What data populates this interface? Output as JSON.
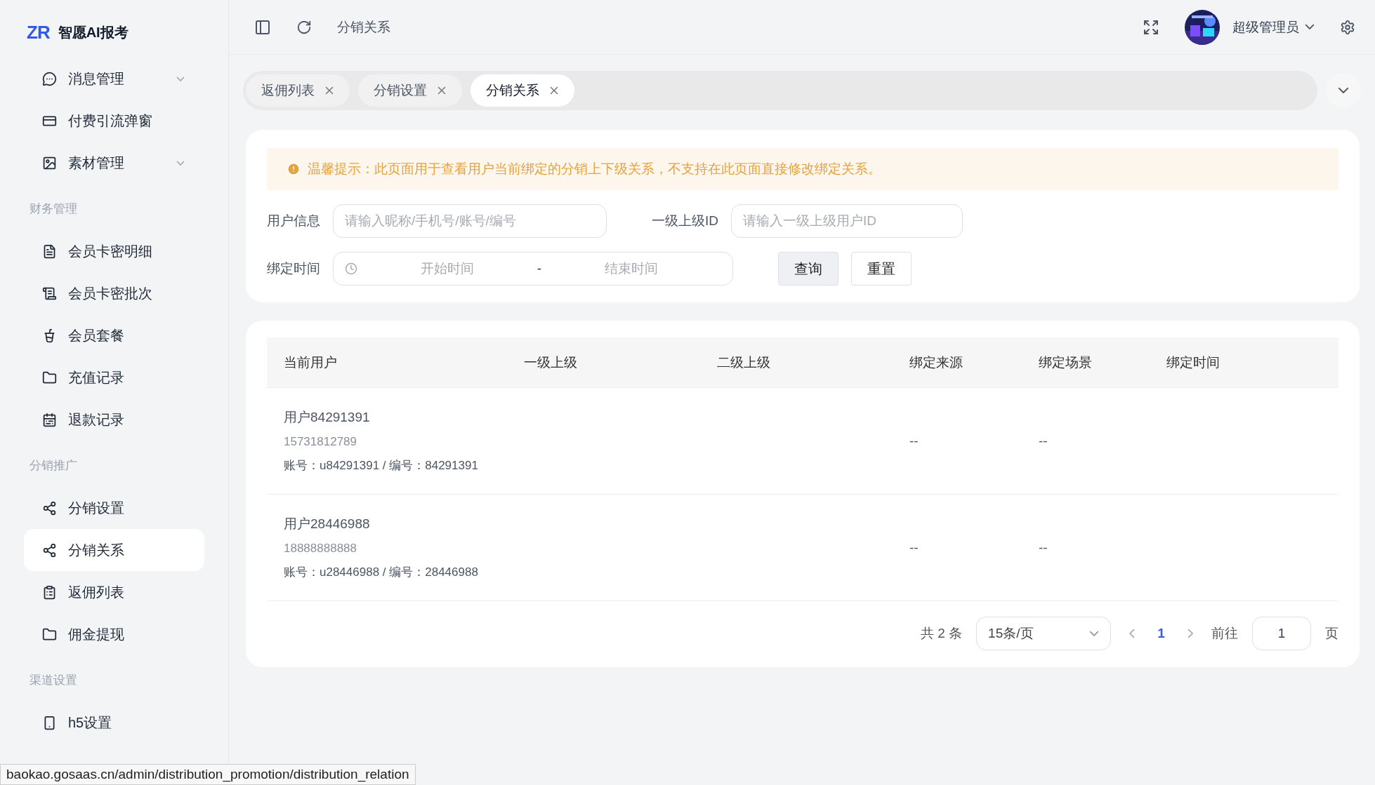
{
  "sidebar": {
    "logo_mark": "ZR",
    "logo_name": "智愿AI报考",
    "items": [
      {
        "kind": "item",
        "label": "消息管理",
        "expanded": false,
        "selected": false
      },
      {
        "kind": "item",
        "label": "付费引流弹窗",
        "selected": false
      },
      {
        "kind": "item",
        "label": "素材管理",
        "expanded": false,
        "selected": false
      },
      {
        "kind": "section",
        "label": "财务管理"
      },
      {
        "kind": "item",
        "label": "会员卡密明细",
        "selected": false
      },
      {
        "kind": "item",
        "label": "会员卡密批次",
        "selected": false
      },
      {
        "kind": "item",
        "label": "会员套餐",
        "selected": false
      },
      {
        "kind": "item",
        "label": "充值记录",
        "selected": false
      },
      {
        "kind": "item",
        "label": "退款记录",
        "selected": false
      },
      {
        "kind": "section",
        "label": "分销推广"
      },
      {
        "kind": "item",
        "label": "分销设置",
        "selected": false
      },
      {
        "kind": "item",
        "label": "分销关系",
        "selected": true
      },
      {
        "kind": "item",
        "label": "返佣列表",
        "selected": false
      },
      {
        "kind": "item",
        "label": "佣金提现",
        "selected": false
      },
      {
        "kind": "section",
        "label": "渠道设置"
      },
      {
        "kind": "item",
        "label": "h5设置",
        "selected": false
      }
    ]
  },
  "header": {
    "breadcrumb": "分销关系",
    "user": "超级管理员"
  },
  "tabs": [
    {
      "label": "返佣列表",
      "selected": false
    },
    {
      "label": "分销设置",
      "selected": false
    },
    {
      "label": "分销关系",
      "selected": true
    }
  ],
  "alert": "温馨提示：此页面用于查看用户当前绑定的分销上下级关系，不支持在此页面直接修改绑定关系。",
  "filters": {
    "user_info": {
      "label": "用户信息",
      "placeholder": "请输入昵称/手机号/账号/编号"
    },
    "parent_id": {
      "label": "一级上级ID",
      "placeholder": "请输入一级上级用户ID"
    },
    "bind_time": {
      "label": "绑定时间",
      "start_placeholder": "开始时间",
      "separator": "-",
      "end_placeholder": "结束时间"
    },
    "buttons": [
      "查询",
      "重置"
    ]
  },
  "table": {
    "columns": [
      "当前用户",
      "一级上级",
      "二级上级",
      "绑定来源",
      "绑定场景",
      "绑定时间"
    ],
    "rows": [
      {
        "name": "用户84291391",
        "phone": "15731812789",
        "account": "账号：u84291391 / 编号：84291391",
        "source": "--",
        "scene": "--"
      },
      {
        "name": "用户28446988",
        "phone": "18888888888",
        "account": "账号：u28446988 / 编号：28446988",
        "source": "--",
        "scene": "--"
      }
    ]
  },
  "pagination": {
    "total": "共 2 条",
    "page_size": "15条/页",
    "pages": [
      {
        "label": "1",
        "selected": true
      }
    ],
    "goto_label": "前往",
    "goto_value": "1",
    "goto_unit": "页"
  },
  "status_bar": "baokao.gosaas.cn/admin/distribution_promotion/distribution_relation"
}
